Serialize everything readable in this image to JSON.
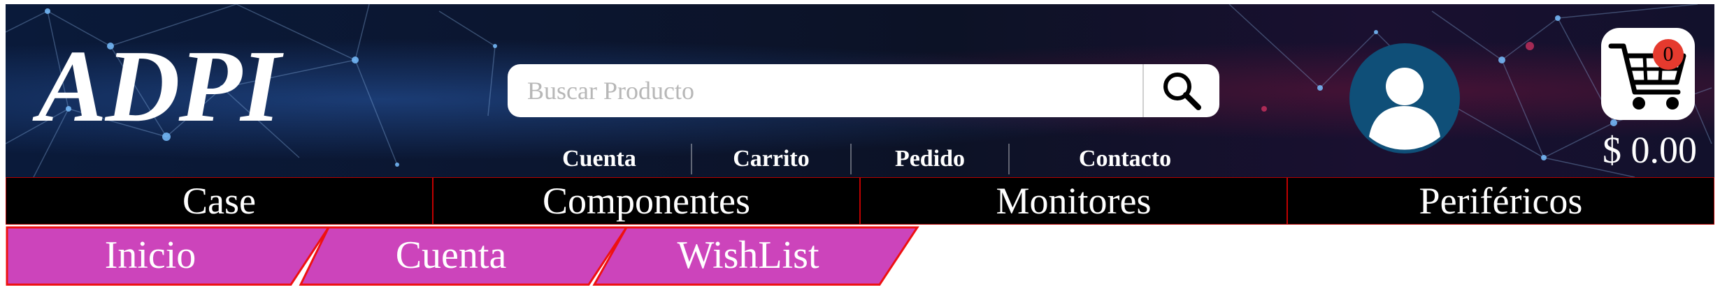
{
  "brand": {
    "logo_text": "ADPI"
  },
  "search": {
    "placeholder": "Buscar Producto",
    "value": "",
    "button_icon": "search-icon"
  },
  "header_links": [
    {
      "label": "Cuenta"
    },
    {
      "label": "Carrito"
    },
    {
      "label": "Pedido"
    },
    {
      "label": "Contacto"
    }
  ],
  "user": {
    "icon": "user-avatar-icon"
  },
  "cart": {
    "icon": "shopping-cart-icon",
    "count": "0",
    "total": "$ 0.00"
  },
  "categories": [
    {
      "label": "Case"
    },
    {
      "label": "Componentes"
    },
    {
      "label": "Monitores"
    },
    {
      "label": "Periféricos"
    }
  ],
  "tabs": [
    {
      "label": "Inicio"
    },
    {
      "label": "Cuenta"
    },
    {
      "label": "WishList"
    }
  ],
  "colors": {
    "header_bg": "#0b1630",
    "nav_bg": "#000000",
    "nav_border": "#c00000",
    "tab_bg": "#cc44bb",
    "tab_border": "#ee1111",
    "avatar_bg": "#0f4f78",
    "badge_bg": "#e53a2e"
  }
}
